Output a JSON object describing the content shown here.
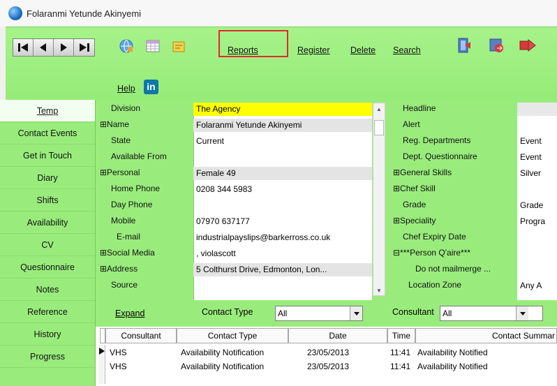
{
  "window": {
    "title": "Folaranmi Yetunde Akinyemi"
  },
  "toolbar": {
    "links": {
      "reports": "Reports",
      "register": "Register",
      "delete": "Delete",
      "search": "Search",
      "help": "Help"
    },
    "icons": [
      "first-record-icon",
      "previous-record-icon",
      "next-record-icon",
      "last-record-icon",
      "globe-icon",
      "grid-icon",
      "note-icon",
      "exit-icon",
      "transfer-icon",
      "close-icon",
      "linkedin-icon"
    ],
    "linkedin_label": "in"
  },
  "nav": {
    "items": [
      "Temp",
      "Contact Events",
      "Get in Touch",
      "Diary",
      "Shifts",
      "Availability",
      "CV",
      "Questionnaire",
      "Notes",
      "Reference",
      "History",
      "Progress"
    ],
    "active": "Temp"
  },
  "details": {
    "left": [
      {
        "label": "Division",
        "value": "The Agency"
      },
      {
        "label": "⊞Name",
        "value": "Folaranmi Yetunde Akinyemi"
      },
      {
        "label": "State",
        "value": "Current"
      },
      {
        "label": "Available From",
        "value": ""
      },
      {
        "label": "⊞Personal",
        "value": "Female 49"
      },
      {
        "label": "Home Phone",
        "value": "0208 344 5983"
      },
      {
        "label": "Day Phone",
        "value": ""
      },
      {
        "label": "Mobile",
        "value": "07970 637177"
      },
      {
        "label": "E-mail",
        "value": "industrialpayslips@barkerross.co.uk"
      },
      {
        "label": "⊞Social Media",
        "value": ", violascott"
      },
      {
        "label": "⊞Address",
        "value": "5 Colthurst Drive, Edmonton, Lon..."
      },
      {
        "label": "Source",
        "value": ""
      }
    ],
    "right": [
      {
        "label": "Headline",
        "value": ""
      },
      {
        "label": "Alert",
        "value": ""
      },
      {
        "label": "Reg. Departments",
        "value": "Event"
      },
      {
        "label": "Dept. Questionnaire",
        "value": "Event"
      },
      {
        "label": "⊞General Skills",
        "value": "Silver"
      },
      {
        "label": "⊞Chef Skill",
        "value": ""
      },
      {
        "label": "Grade",
        "value": "Grade"
      },
      {
        "label": "⊞Speciality",
        "value": "Progra"
      },
      {
        "label": "Chef Expiry Date",
        "value": ""
      },
      {
        "label": "⊟***Person Q'aire***",
        "value": ""
      },
      {
        "label": "Do not mailmerge ...",
        "value": ""
      },
      {
        "label": "Location Zone",
        "value": "Any A"
      }
    ]
  },
  "filters": {
    "expand": "Expand",
    "contact_type_label": "Contact Type",
    "contact_type_value": "All",
    "consultant_label": "Consultant",
    "consultant_value": "All"
  },
  "grid": {
    "columns": [
      "Consultant",
      "Contact Type",
      "Date",
      "Time",
      "Contact Summar"
    ],
    "rows": [
      {
        "consultant": "VHS",
        "contact_type": "Availability Notification",
        "date": "23/05/2013",
        "time": "11:41",
        "summary": "Availability Notified"
      },
      {
        "consultant": "VHS",
        "contact_type": "Availability Notification",
        "date": "23/05/2013",
        "time": "11:41",
        "summary": "Availability Notified"
      }
    ]
  },
  "colors": {
    "panel_green": "#99ec7c",
    "highlight_yellow": "#ffff00",
    "reports_outline": "#e02a2a",
    "linkedin_blue": "#0e76a8"
  }
}
